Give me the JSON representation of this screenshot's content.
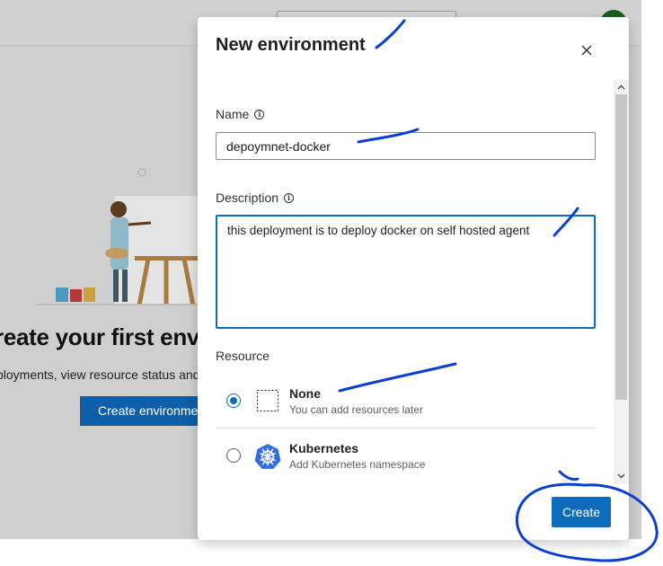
{
  "background": {
    "heading": "reate your first env",
    "subtext": "ployments, view resource status and",
    "create_button_label": "Create environment"
  },
  "dialog": {
    "title": "New environment",
    "name_label": "Name",
    "name_value": "depoymnet-docker",
    "description_label": "Description",
    "description_value": "this deployment is to deploy docker on self hosted agent",
    "resource_label": "Resource",
    "resources": [
      {
        "title": "None",
        "description": "You can add resources later",
        "selected": true,
        "icon": "dashed-box-icon"
      },
      {
        "title": "Kubernetes",
        "description": "Add Kubernetes namespace",
        "selected": false,
        "icon": "kubernetes-icon"
      }
    ],
    "create_button_label": "Create"
  },
  "colors": {
    "accent": "#0f6cbd",
    "annotation_ink": "#0a3fd1",
    "kubernetes_blue": "#326ce5"
  }
}
